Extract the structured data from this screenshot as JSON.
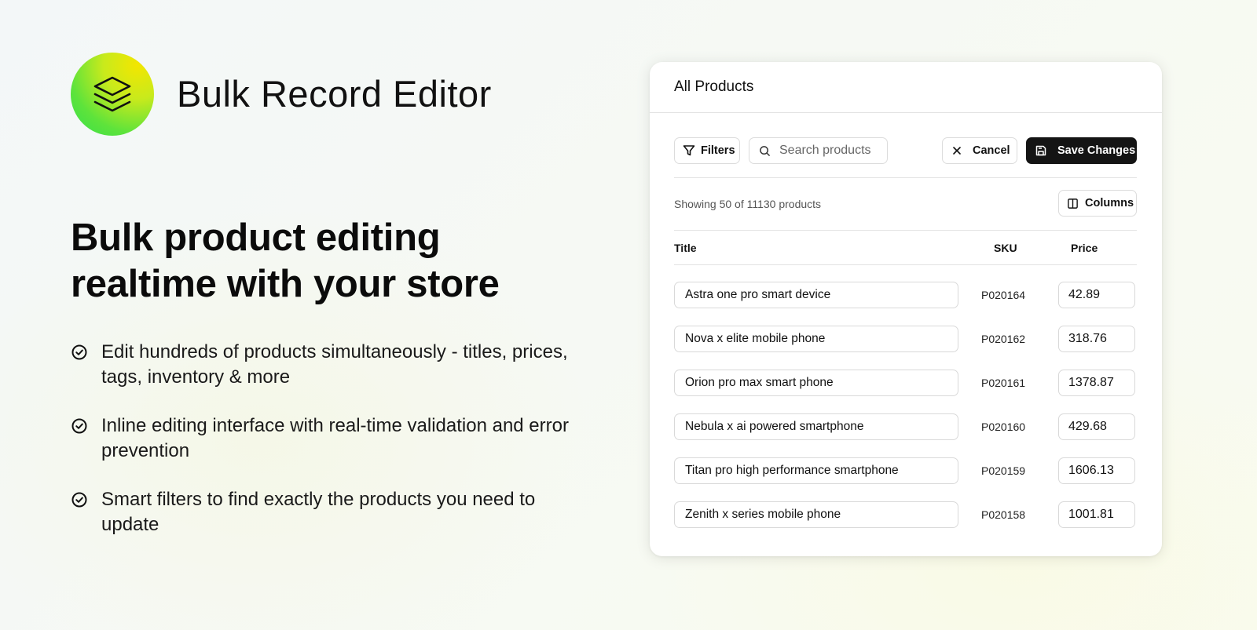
{
  "brand": {
    "app_name": "Bulk Record Editor",
    "logo_icon": "layers-icon",
    "logo_colors": [
      "#f3e600",
      "#5ee33b",
      "#33e04c"
    ]
  },
  "hero": {
    "headline_line1": "Bulk product editing",
    "headline_line2": "realtime with your store"
  },
  "features": [
    {
      "icon": "check-circle-icon",
      "text": "Edit hundreds of products simultaneously - titles, prices, tags, inventory & more"
    },
    {
      "icon": "check-circle-icon",
      "text": "Inline editing interface with real-time validation and error prevention"
    },
    {
      "icon": "check-circle-icon",
      "text": "Smart filters to find exactly the products you need to update"
    }
  ],
  "editor": {
    "title": "All Products",
    "toolbar": {
      "filters_label": "Filters",
      "filters_icon": "filter-icon",
      "search_placeholder": "Search products",
      "search_value": "",
      "search_icon": "search-icon",
      "cancel_label": "Cancel",
      "cancel_icon": "close-icon",
      "save_label": "Save Changes",
      "save_icon": "save-icon"
    },
    "count_text": "Showing 50 of 11130 products",
    "columns_label": "Columns",
    "columns_icon": "columns-icon",
    "table": {
      "headers": {
        "title": "Title",
        "sku": "SKU",
        "price": "Price"
      },
      "rows": [
        {
          "title": "Astra one pro smart device",
          "sku": "P020164",
          "price": "42.89"
        },
        {
          "title": "Nova x elite mobile phone",
          "sku": "P020162",
          "price": "318.76"
        },
        {
          "title": "Orion pro max smart phone",
          "sku": "P020161",
          "price": "1378.87"
        },
        {
          "title": "Nebula x ai powered smartphone",
          "sku": "P020160",
          "price": "429.68"
        },
        {
          "title": "Titan pro high performance smartphone",
          "sku": "P020159",
          "price": "1606.13"
        },
        {
          "title": "Zenith x series mobile phone",
          "sku": "P020158",
          "price": "1001.81"
        }
      ]
    }
  },
  "colors": {
    "primary_button": "#141414",
    "border": "#dcdcdc",
    "text": "#111111"
  }
}
